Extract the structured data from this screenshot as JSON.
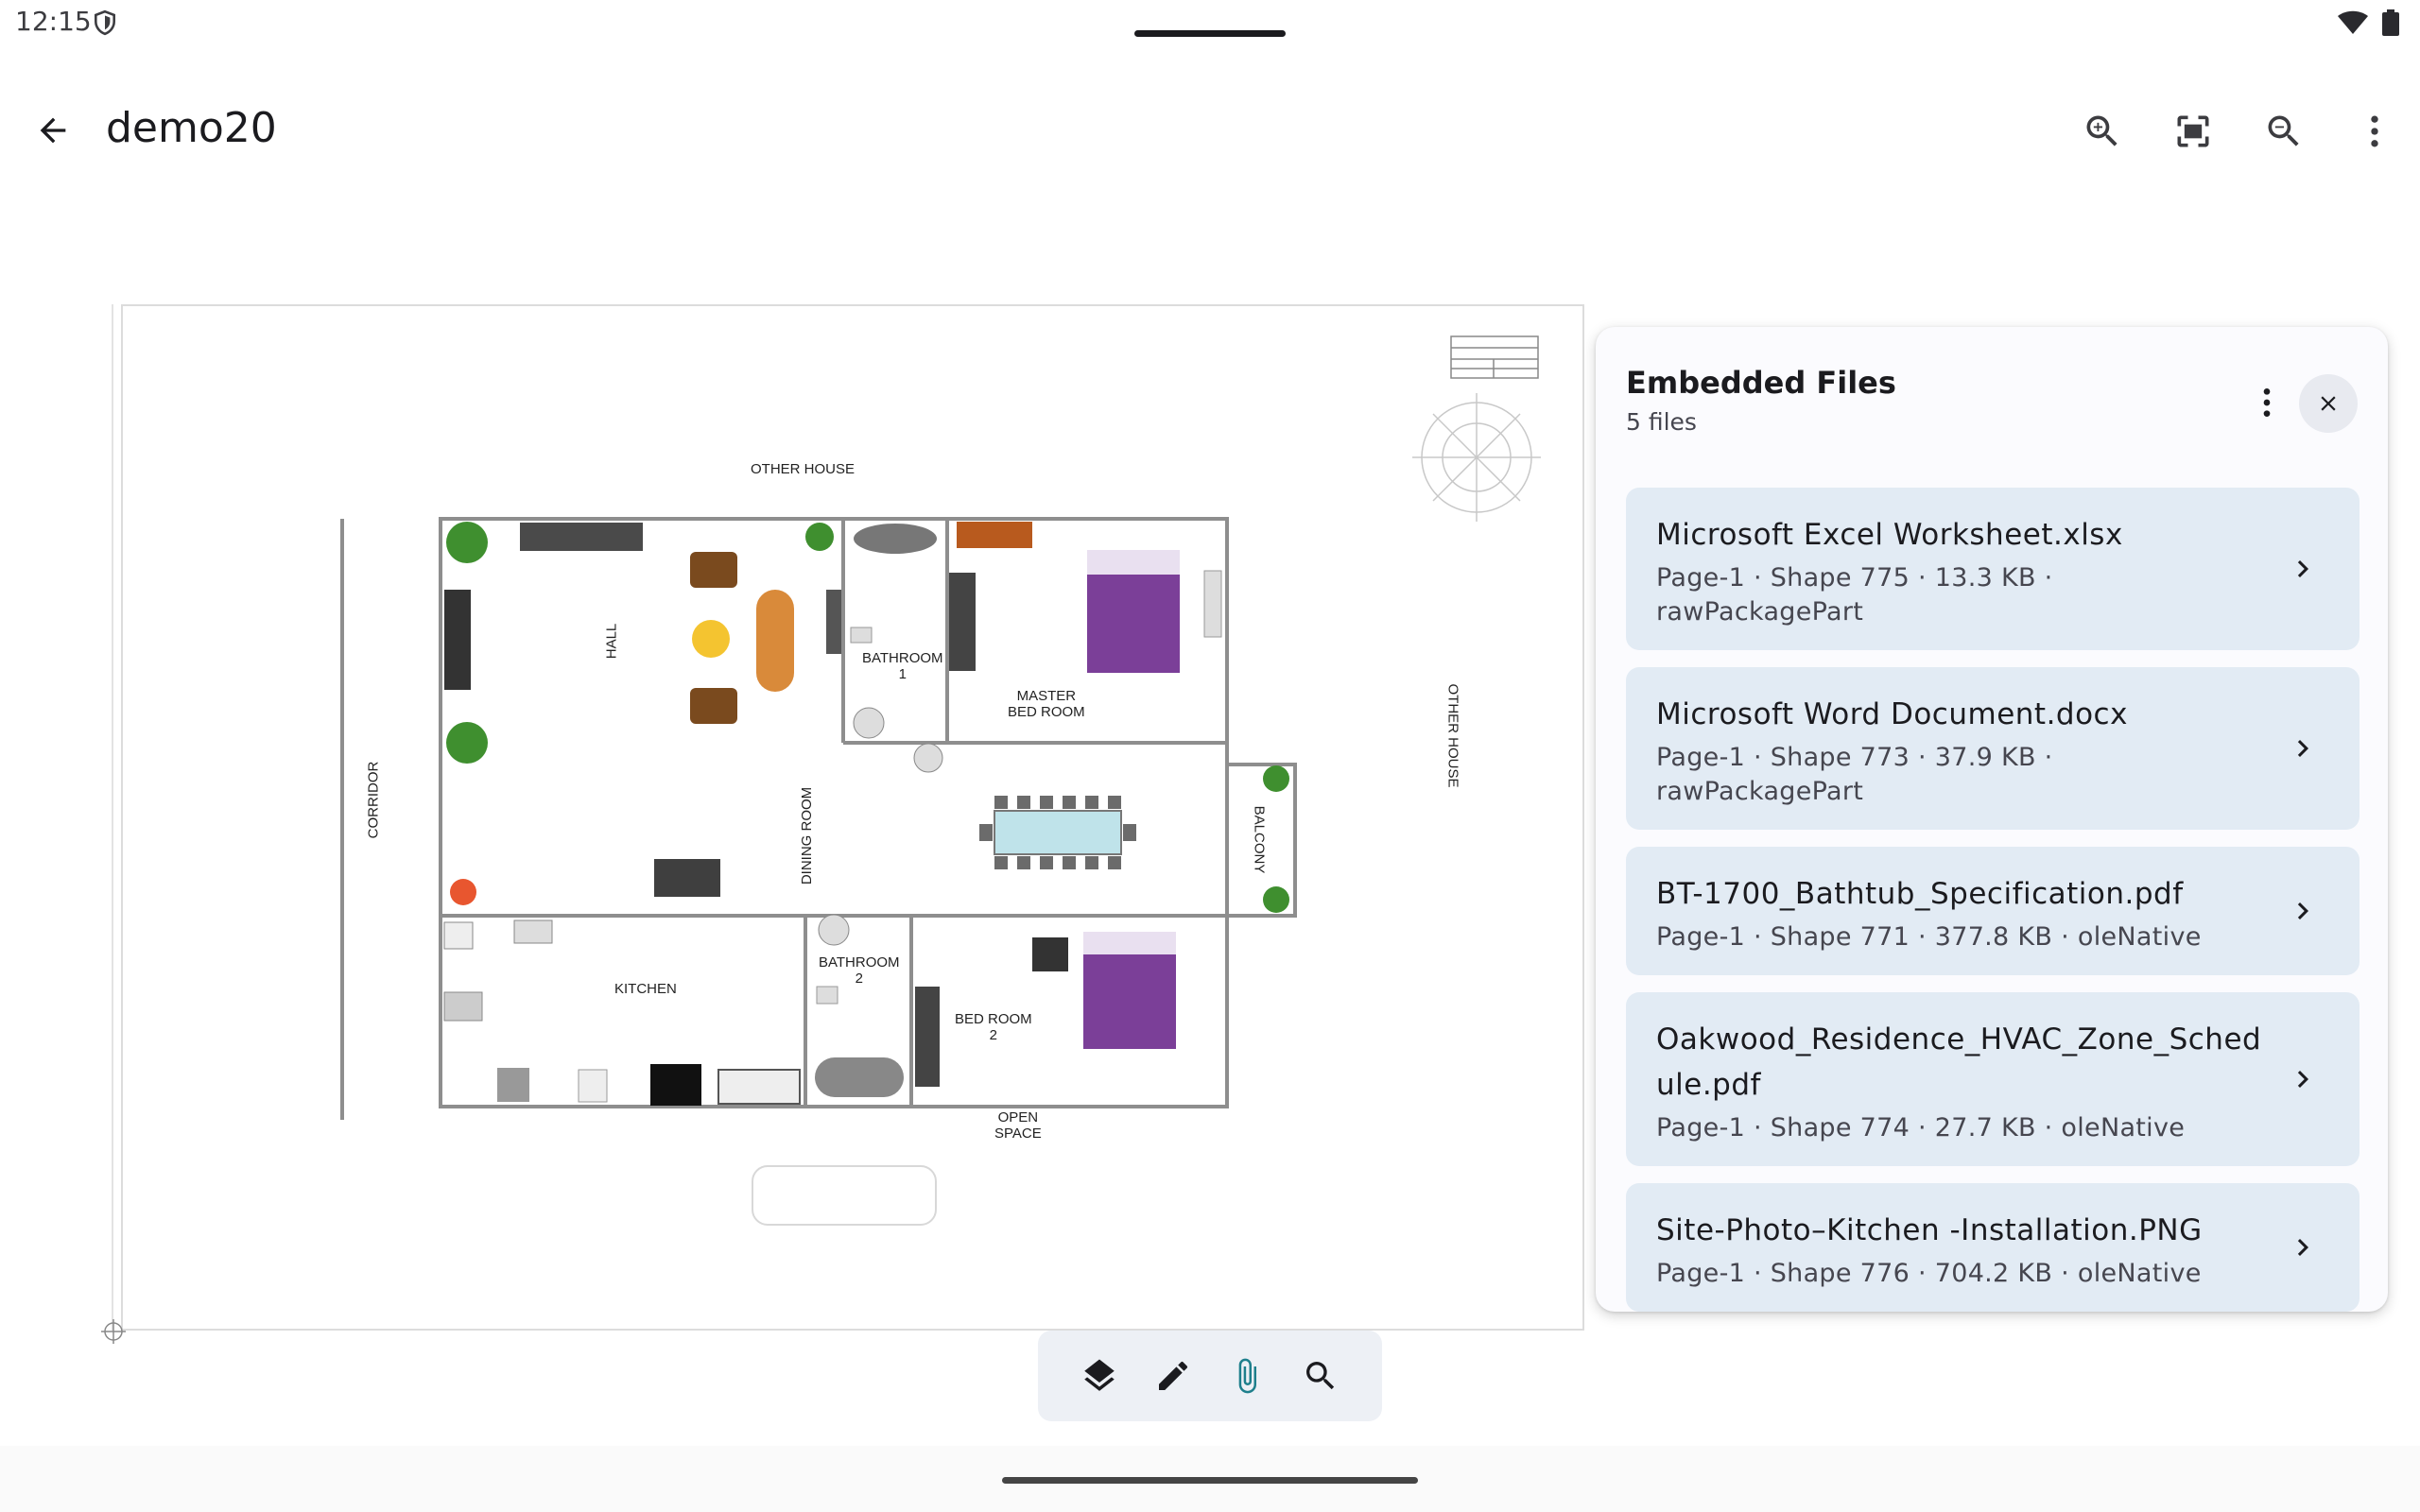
{
  "status_bar": {
    "time": "12:15"
  },
  "app_bar": {
    "title": "demo20",
    "actions": [
      "zoom-in-icon",
      "fit-screen-icon",
      "zoom-out-icon",
      "more-vert-icon"
    ]
  },
  "drawing": {
    "labels": {
      "other_house_top": "OTHER HOUSE",
      "other_house_right": "OTHER HOUSE",
      "hall": "HALL",
      "corridor": "CORRIDOR",
      "bathroom1_a": "BATHROOM",
      "bathroom1_b": "1",
      "master_a": "MASTER",
      "master_b": "BED ROOM",
      "dining": "DINING ROOM",
      "balcony": "BALCONY",
      "kitchen": "KITCHEN",
      "bathroom2_a": "BATHROOM",
      "bathroom2_b": "2",
      "bedroom2_a": "BED ROOM",
      "bedroom2_b": "2",
      "open_a": "OPEN",
      "open_b": "SPACE"
    },
    "colors": {
      "wall": "#8e8e8e",
      "bed": "#7b3f98",
      "plant": "#3f8f2f",
      "table": "#bfe3ea",
      "sofa": "#d98a3a",
      "lamp": "#f4c430",
      "stool": "#e8562f"
    }
  },
  "panel": {
    "title": "Embedded Files",
    "count": "5 files",
    "files": [
      {
        "name": "Microsoft Excel Worksheet.xlsx",
        "meta": "Page-1 · Shape 775 · 13.3 KB · rawPackagePart"
      },
      {
        "name": "Microsoft Word Document.docx",
        "meta": "Page-1 · Shape 773 · 37.9 KB · rawPackagePart"
      },
      {
        "name": "BT-1700_Bathtub_Specification.pdf",
        "meta": "Page-1 · Shape 771 · 377.8 KB · oleNative"
      },
      {
        "name": "Oakwood_Residence_HVAC_Zone_Schedule.pdf",
        "meta": "Page-1 · Shape 774 · 27.7 KB · oleNative"
      },
      {
        "name": "Site-Photo–Kitchen -Installation.PNG",
        "meta": "Page-1 · Shape 776 · 704.2 KB · oleNative"
      }
    ]
  },
  "toolbar": {
    "tools": [
      "layers-icon",
      "edit-pencil-icon",
      "attachment-icon",
      "search-icon"
    ],
    "active": "attachment-icon",
    "active_color": "#1e7f8c"
  }
}
